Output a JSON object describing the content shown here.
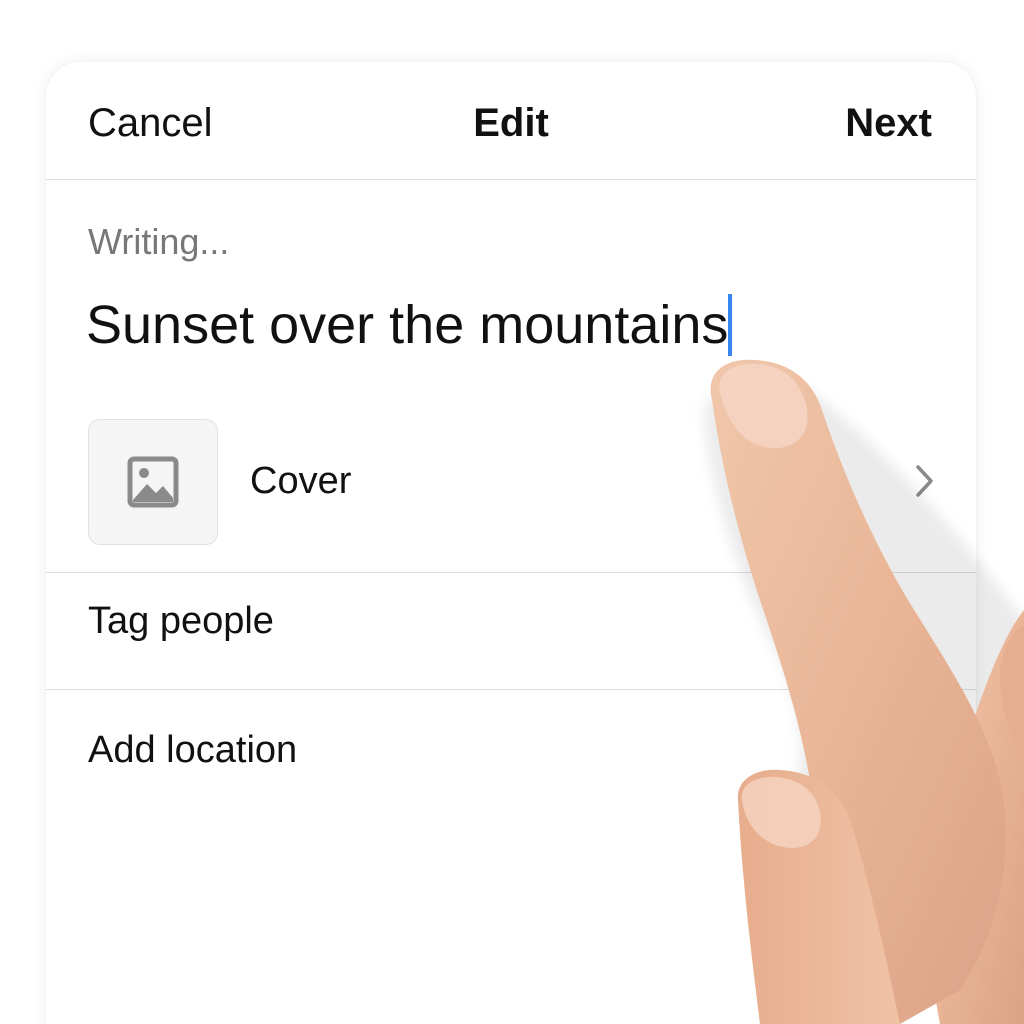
{
  "navbar": {
    "cancel_label": "Cancel",
    "title": "Edit",
    "next_label": "Next"
  },
  "composer": {
    "status": "Writing...",
    "caption_value": "Sunset over the mountains"
  },
  "rows": {
    "cover": {
      "label": "Cover",
      "icon": "image-icon",
      "trailing_icon": "chevron-right-icon"
    },
    "tag_people": {
      "label": "Tag people"
    },
    "add_location": {
      "label": "Add location"
    }
  },
  "colors": {
    "text": "#111111",
    "muted_text": "#777777",
    "cursor": "#3a86f0",
    "divider": "#dedede",
    "thumb_bg": "#f5f5f5"
  }
}
